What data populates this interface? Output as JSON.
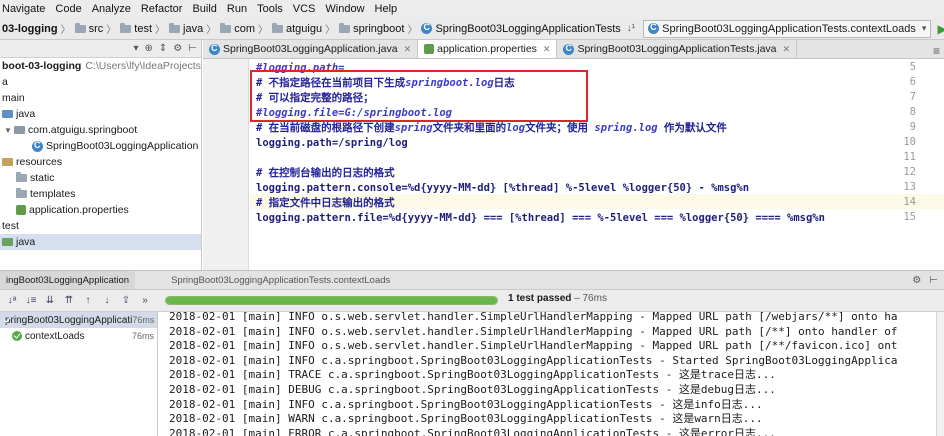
{
  "menu": [
    "Navigate",
    "Code",
    "Analyze",
    "Refactor",
    "Build",
    "Run",
    "Tools",
    "VCS",
    "Window",
    "Help"
  ],
  "breadcrumbs": [
    "03-logging",
    "src",
    "test",
    "java",
    "com",
    "atguigu",
    "springboot",
    "SpringBoot03LoggingApplicationTests"
  ],
  "run_config": "SpringBoot03LoggingApplicationTests.contextLoads",
  "tree": {
    "project_name": "boot-03-logging",
    "project_path": "C:\\Users\\lfy\\IdeaProjects\\sp",
    "items": [
      {
        "label": "a",
        "kind": "text"
      },
      {
        "label": "main",
        "kind": "text"
      },
      {
        "label": "java",
        "kind": "src"
      },
      {
        "label": "com.atguigu.springboot",
        "kind": "pkg"
      },
      {
        "label": "SpringBoot03LoggingApplication",
        "kind": "class"
      },
      {
        "label": "resources",
        "kind": "res"
      },
      {
        "label": "static",
        "kind": "folder"
      },
      {
        "label": "templates",
        "kind": "folder"
      },
      {
        "label": "application.properties",
        "kind": "props"
      },
      {
        "label": "test",
        "kind": "text"
      },
      {
        "label": "java",
        "kind": "test"
      }
    ]
  },
  "tabs": [
    {
      "label": "SpringBoot03LoggingApplication.java",
      "active": false
    },
    {
      "label": "application.properties",
      "active": true
    },
    {
      "label": "SpringBoot03LoggingApplicationTests.java",
      "active": false
    }
  ],
  "editor": {
    "lines": [
      {
        "num": "5",
        "parts": [
          {
            "t": "#logging.path=",
            "c": "cmt"
          }
        ]
      },
      {
        "num": "6",
        "parts": [
          {
            "t": "# 不指定路径在当前项目下生成",
            "c": "cmt-cn"
          },
          {
            "t": "springboot.log",
            "c": "cmt"
          },
          {
            "t": "日志",
            "c": "cmt-cn"
          }
        ]
      },
      {
        "num": "7",
        "parts": [
          {
            "t": "# 可以指定完整的路径；",
            "c": "cmt-cn"
          }
        ]
      },
      {
        "num": "8",
        "parts": [
          {
            "t": "#logging.file=G:/springboot.log",
            "c": "cmt"
          }
        ]
      },
      {
        "num": "9",
        "parts": [
          {
            "t": "# 在当前磁盘的根路径下创建",
            "c": "cmt-cn"
          },
          {
            "t": "spring",
            "c": "cmt"
          },
          {
            "t": "文件夹和里面的",
            "c": "cmt-cn"
          },
          {
            "t": "log",
            "c": "cmt"
          },
          {
            "t": "文件夹；使用  ",
            "c": "cmt-cn"
          },
          {
            "t": "spring.log",
            "c": "cmt"
          },
          {
            "t": " 作为默认文件",
            "c": "cmt-cn"
          }
        ]
      },
      {
        "num": "10",
        "parts": [
          {
            "t": "logging.path=/spring/log",
            "c": "key"
          }
        ]
      },
      {
        "num": "11",
        "parts": [
          {
            "t": "",
            "c": "key"
          }
        ]
      },
      {
        "num": "12",
        "parts": [
          {
            "t": "#  在控制台输出的日志的格式",
            "c": "cmt-cn"
          }
        ]
      },
      {
        "num": "13",
        "parts": [
          {
            "t": "logging.pattern.console=%d{yyyy-MM-dd} [%thread] %-5level %logger{50} - %msg%n",
            "c": "key"
          }
        ]
      },
      {
        "num": "14",
        "parts": [
          {
            "t": "# 指定文件中日志输出的格式",
            "c": "cmt-cn"
          }
        ]
      },
      {
        "num": "15",
        "parts": [
          {
            "t": "logging.pattern.file=%d{yyyy-MM-dd} === [%thread] === %-5level === %logger{50} ==== %msg%n",
            "c": "key"
          }
        ]
      }
    ]
  },
  "run": {
    "tab_label": "ingBoot03LoggingApplication",
    "sub_tab_label": "SpringBoot03LoggingApplicationTests.contextLoads",
    "progress_fraction": 1.0,
    "status": "1 test passed",
    "duration": "– 76ms",
    "tests": [
      {
        "label": "pringBoot03LoggingApplicati",
        "time": "76ms"
      },
      {
        "label": "contextLoads",
        "time": "76ms"
      }
    ],
    "log": [
      "2018-02-01 [main] INFO  o.s.web.servlet.handler.SimpleUrlHandlerMapping - Mapped URL path [/webjars/**] onto ha",
      "2018-02-01 [main] INFO  o.s.web.servlet.handler.SimpleUrlHandlerMapping - Mapped URL path [/**] onto handler of",
      "2018-02-01 [main] INFO  o.s.web.servlet.handler.SimpleUrlHandlerMapping - Mapped URL path [/**/favicon.ico] ont",
      "2018-02-01 [main] INFO  c.a.springboot.SpringBoot03LoggingApplicationTests - Started SpringBoot03LoggingApplica",
      "2018-02-01 [main] TRACE c.a.springboot.SpringBoot03LoggingApplicationTests - 这是trace日志...",
      "2018-02-01 [main] DEBUG c.a.springboot.SpringBoot03LoggingApplicationTests - 这是debug日志...",
      "2018-02-01 [main] INFO  c.a.springboot.SpringBoot03LoggingApplicationTests - 这是info日志...",
      "2018-02-01 [main] WARN  c.a.springboot.SpringBoot03LoggingApplicationTests - 这是warn日志...",
      "2018-02-01 [main] ERROR c.a.springboot.SpringBoot03LoggingApplicationTests - 这是error日志..."
    ]
  },
  "colors": {
    "highlight_box": "#e0242a",
    "pass": "#6ab84a"
  }
}
